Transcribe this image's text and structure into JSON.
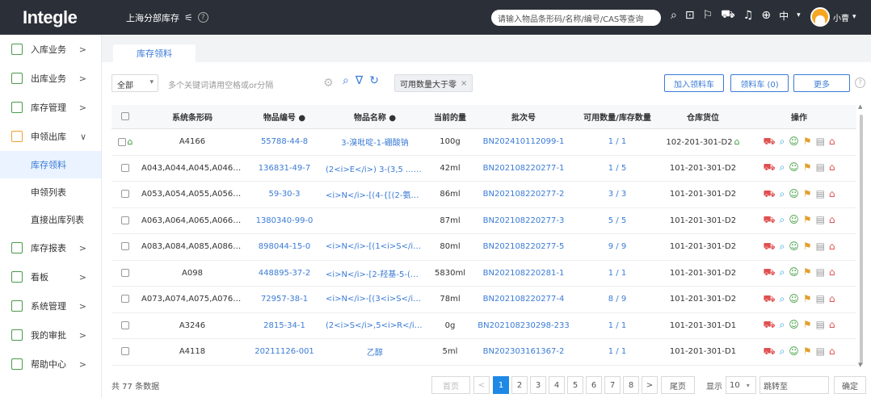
{
  "app": {
    "logo": "Integle"
  },
  "topbar": {
    "branch_label": "上海分部库存",
    "search_placeholder": "请输入物品条形码/名称/编号/CAS等查询",
    "lang_label": "中",
    "user_name": "小曹"
  },
  "sidebar": {
    "items": [
      {
        "label": "入库业务",
        "expanded": false
      },
      {
        "label": "出库业务",
        "expanded": false
      },
      {
        "label": "库存管理",
        "expanded": false
      },
      {
        "label": "申领出库",
        "expanded": true
      },
      {
        "label": "库存报表",
        "expanded": false
      },
      {
        "label": "看板",
        "expanded": false
      },
      {
        "label": "系统管理",
        "expanded": false
      },
      {
        "label": "我的审批",
        "expanded": false
      },
      {
        "label": "帮助中心",
        "expanded": false
      }
    ],
    "sub_items": [
      {
        "label": "库存领料",
        "active": true
      },
      {
        "label": "申领列表",
        "active": false
      },
      {
        "label": "直接出库列表",
        "active": false
      }
    ]
  },
  "tabs": [
    {
      "label": "库存领料"
    }
  ],
  "toolbar": {
    "scope_select": "全部",
    "keyword_placeholder": "多个关键词请用空格或or分隔",
    "filter_chip": "可用数量大于零",
    "add_cart_label": "加入领料车",
    "cart_label": "领料车 (0)",
    "more_label": "更多"
  },
  "table": {
    "columns": [
      "系统条形码",
      "物品编号 ●",
      "物品名称 ●",
      "当前的量",
      "批次号",
      "可用数量/库存数量",
      "仓库货位",
      "操作"
    ],
    "rows": [
      {
        "barcode": "A4166",
        "code": "55788-44-8",
        "name": "3-溴吡啶-1-硼酸钠",
        "amount": "100g",
        "batch": "BN202410112099-1",
        "qty": "1 / 1",
        "location": "102-201-301-D2",
        "home": true
      },
      {
        "barcode": "A043,A044,A045,A046,A...",
        "code": "136831-49-7",
        "name": "(2<i>E</i>) 3-(3,5 ...氧...",
        "amount": "42ml",
        "batch": "BN202108220277-1",
        "qty": "1 / 5",
        "location": "101-201-301-D2",
        "home": false
      },
      {
        "barcode": "A053,A054,A055,A056,A...",
        "code": "59-30-3",
        "name": "<i>N</i>-[(4-{[(2-氨基-...",
        "amount": "86ml",
        "batch": "BN202108220277-2",
        "qty": "3 / 3",
        "location": "101-201-301-D2",
        "home": false
      },
      {
        "barcode": "A063,A064,A065,A066,A...",
        "code": "1380340-99-0",
        "name": "",
        "amount": "87ml",
        "batch": "BN202108220277-3",
        "qty": "5 / 5",
        "location": "101-201-301-D2",
        "home": false
      },
      {
        "barcode": "A083,A084,A085,A086,A...",
        "code": "898044-15-0",
        "name": "<i>N</i>-[(1<i>S</i>)...",
        "amount": "80ml",
        "batch": "BN202108220277-5",
        "qty": "9 / 9",
        "location": "101-201-301-D2",
        "home": false
      },
      {
        "barcode": "A098",
        "code": "448895-37-2",
        "name": "<i>N</i>-[2-羟基-5-(三...",
        "amount": "5830ml",
        "batch": "BN202108220281-1",
        "qty": "1 / 1",
        "location": "101-201-301-D2",
        "home": false
      },
      {
        "barcode": "A073,A074,A075,A076,A...",
        "code": "72957-38-1",
        "name": "<i>N</i>-[(3<i>S</i>)...",
        "amount": "78ml",
        "batch": "BN202108220277-4",
        "qty": "8 / 9",
        "location": "101-201-301-D2",
        "home": false
      },
      {
        "barcode": "A3246",
        "code": "2815-34-1",
        "name": "(2<i>S</i>,5<i>R</i>)-...",
        "amount": "0g",
        "batch": "BN202108230298-233",
        "qty": "1 / 1",
        "location": "101-201-301-D1",
        "home": false
      },
      {
        "barcode": "A4118",
        "code": "20211126-001",
        "name": "乙醇",
        "amount": "5ml",
        "batch": "BN202303161367-2",
        "qty": "1 / 1",
        "location": "101-201-301-D1",
        "home": false
      }
    ]
  },
  "pagination": {
    "total": "共 77 条数据",
    "first": "首页",
    "prev": "<",
    "pages": [
      "1",
      "2",
      "3",
      "4",
      "5",
      "6",
      "7",
      "8"
    ],
    "current": "1",
    "next": ">",
    "last": "尾页",
    "show_label": "显示",
    "page_size": "10",
    "jump_label": "跳转至",
    "confirm": "确定"
  },
  "colors": {
    "topbar": "#2b3038",
    "accent": "#3a7bd5",
    "active_page": "#1e88e5"
  }
}
